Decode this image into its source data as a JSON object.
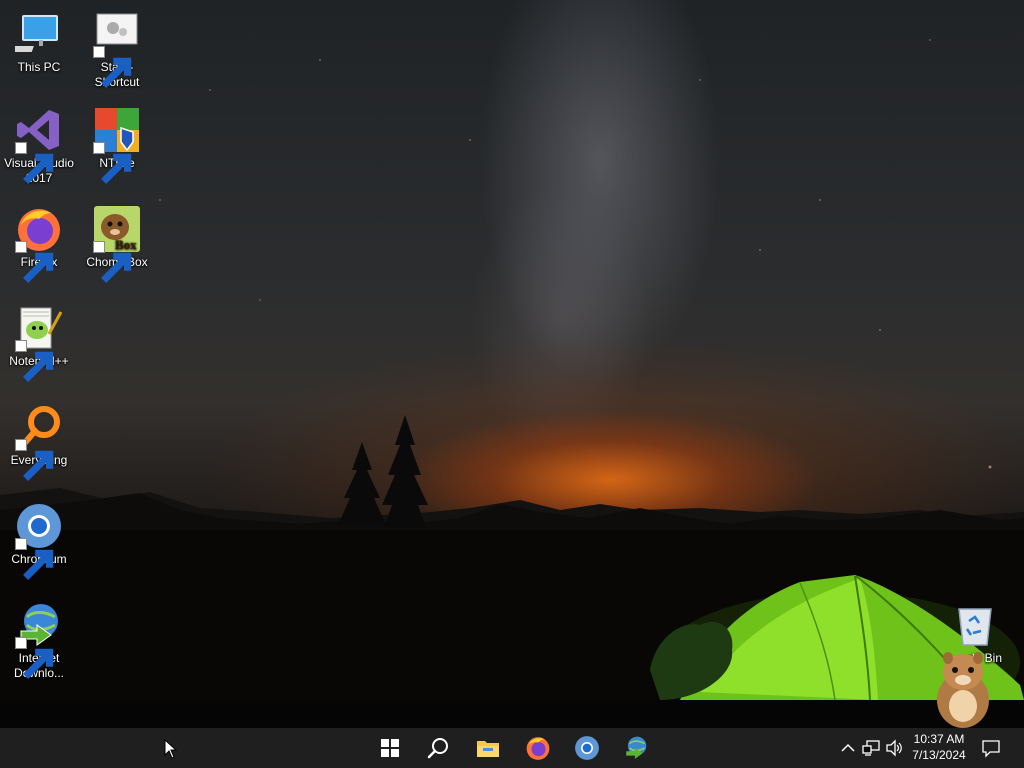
{
  "desktop": {
    "icons": [
      {
        "label": "This PC",
        "icon": "this-pc-icon"
      },
      {
        "label": "Start - Shortcut",
        "icon": "start-shortcut-icon"
      },
      {
        "label": "Visual Studio 2017",
        "icon": "visual-studio-icon"
      },
      {
        "label": "NTLite",
        "icon": "ntlite-icon"
      },
      {
        "label": "Firefox",
        "icon": "firefox-icon"
      },
      {
        "label": "ChomikBox",
        "icon": "chomikbox-icon",
        "icon_text": "Box"
      },
      {
        "label": "Notepad++",
        "icon": "notepad-plus-plus-icon"
      },
      {
        "label": "Everything",
        "icon": "everything-search-icon"
      },
      {
        "label": "Chromium",
        "icon": "chromium-icon"
      },
      {
        "label": "Internet Downlo...",
        "icon": "internet-download-manager-icon"
      },
      {
        "label": "Recycle Bin",
        "visible_label": "cle Bin",
        "icon": "recycle-bin-icon"
      }
    ]
  },
  "taskbar": {
    "pinned": [
      "start-button",
      "search-button",
      "file-explorer-icon",
      "firefox-icon",
      "chromium-icon",
      "internet-download-manager-icon"
    ],
    "tray": {
      "icons": [
        "show-hidden-icons-chevron",
        "network-icon",
        "volume-icon",
        "notifications-icon"
      ],
      "time": "10:37 AM",
      "date": "7/13/2024"
    }
  },
  "colors": {
    "taskbar_bg": "#0c0c0c",
    "tent_green": "#7ad11c",
    "horizon_orange": "#ff7a14"
  }
}
